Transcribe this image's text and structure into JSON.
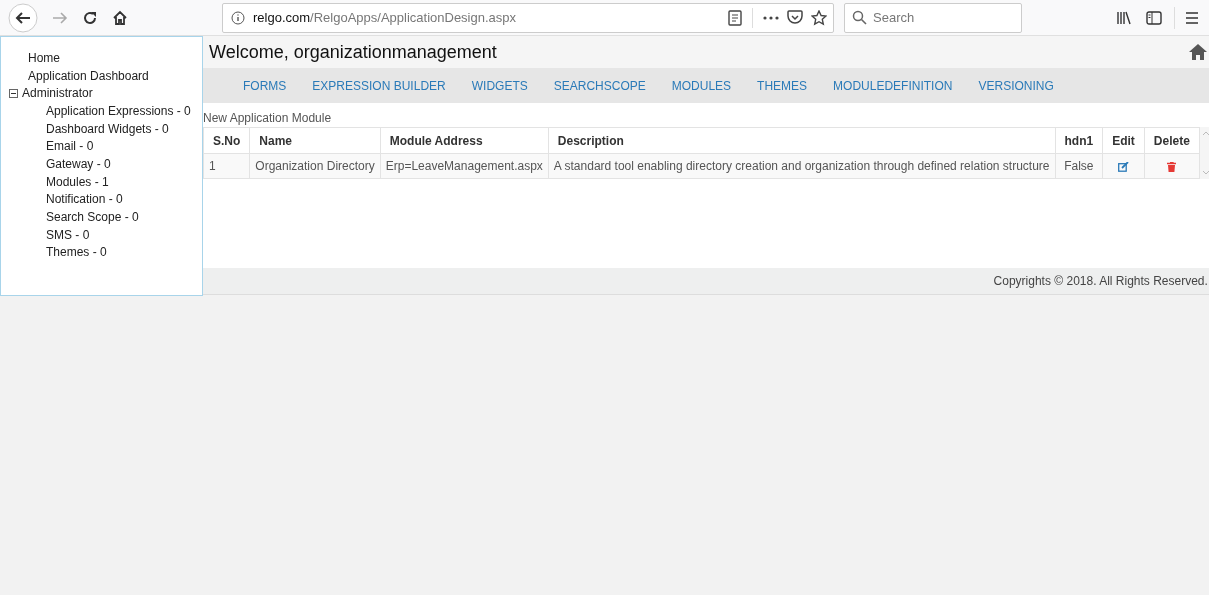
{
  "browser": {
    "url_host": "relgo.com",
    "url_path": "/RelgoApps/ApplicationDesign.aspx",
    "search": {
      "placeholder": "Search"
    }
  },
  "sidebar": {
    "items": [
      {
        "label": "Home"
      },
      {
        "label": "Application Dashboard"
      },
      {
        "label": "Administrator",
        "expanded": true,
        "children": [
          {
            "label": "Application Expressions - 0"
          },
          {
            "label": "Dashboard Widgets - 0"
          },
          {
            "label": "Email - 0"
          },
          {
            "label": "Gateway - 0"
          },
          {
            "label": "Modules - 1"
          },
          {
            "label": "Notification - 0"
          },
          {
            "label": "Search Scope - 0"
          },
          {
            "label": "SMS - 0"
          },
          {
            "label": "Themes - 0"
          }
        ]
      }
    ]
  },
  "header": {
    "title": "Welcome, organizationmanagement"
  },
  "nav": [
    "FORMS",
    "EXPRESSION BUILDER",
    "WIDGETS",
    "SEARCHSCOPE",
    "MODULES",
    "THEMES",
    "MODULEDEFINITION",
    "VERSIONING"
  ],
  "link": "New Application Module",
  "table": {
    "columns": [
      "S.No",
      "Name",
      "Module Address",
      "Description",
      "hdn1",
      "Edit",
      "Delete"
    ],
    "rows": [
      [
        "1",
        "Organization Directory",
        "Erp=LeaveManagement.aspx",
        "A standard tool enabling directory creation and organization through defined relation structure",
        "False"
      ]
    ]
  },
  "footer": "Copyrights © 2018. All Rights Reserved."
}
